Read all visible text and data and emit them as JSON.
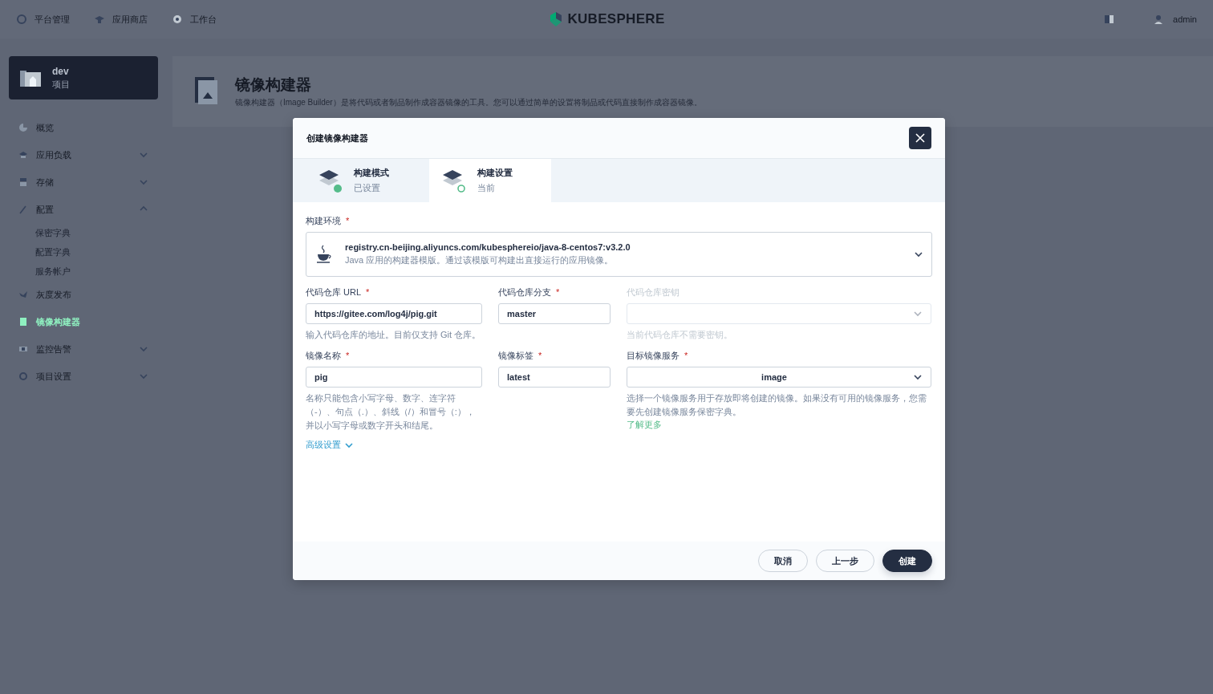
{
  "top_nav": {
    "items": [
      {
        "label": "平台管理"
      },
      {
        "label": "应用商店"
      },
      {
        "label": "工作台"
      }
    ],
    "logo": "KUBESPHERE",
    "user": "admin"
  },
  "sidebar": {
    "project": {
      "name": "dev",
      "type": "项目"
    },
    "items": [
      {
        "label": "概览",
        "kind": "link",
        "selected": false
      },
      {
        "label": "应用负载",
        "kind": "group",
        "expanded": false,
        "selected": false
      },
      {
        "label": "存储",
        "kind": "group",
        "expanded": false,
        "selected": false
      },
      {
        "label": "配置",
        "kind": "group",
        "expanded": true,
        "selected": false,
        "children": [
          {
            "label": "保密字典",
            "selected": false
          },
          {
            "label": "配置字典",
            "selected": false
          },
          {
            "label": "服务帐户",
            "selected": false
          }
        ]
      },
      {
        "label": "灰度发布",
        "kind": "link",
        "selected": false
      },
      {
        "label": "镜像构建器",
        "kind": "link",
        "selected": true
      },
      {
        "label": "监控告警",
        "kind": "group",
        "expanded": false,
        "selected": false
      },
      {
        "label": "项目设置",
        "kind": "group",
        "expanded": false,
        "selected": false
      }
    ]
  },
  "page_header": {
    "title": "镜像构建器",
    "description": "镜像构建器（Image Builder）是将代码或者制品制作成容器镜像的工具。您可以通过简单的设置将制品或代码直接制作成容器镜像。"
  },
  "modal": {
    "title": "创建镜像构建器",
    "required_mark": "*",
    "steps": [
      {
        "title": "构建模式",
        "status": "已设置",
        "done": true,
        "selected": false
      },
      {
        "title": "构建设置",
        "status": "当前",
        "done": false,
        "selected": true
      }
    ],
    "environment": {
      "label": "构建环境",
      "required": true,
      "value": "registry.cn-beijing.aliyuncs.com/kubesphereio/java-8-centos7:v3.2.0",
      "description": "Java 应用的构建器模版。通过该模版可构建出直接运行的应用镜像。"
    },
    "fields": [
      {
        "label": "代码仓库 URL",
        "required": true,
        "kind": "input",
        "value": "https://gitee.com/log4j/pig.git",
        "hint": "输入代码仓库的地址。目前仅支持 Git 仓库。"
      },
      {
        "label": "代码仓库分支",
        "required": true,
        "kind": "input",
        "value": "master"
      },
      {
        "label": "代码仓库密钥",
        "required": false,
        "kind": "select",
        "hint": "当前代码仓库不需要密钥。",
        "disabled": true
      },
      {
        "label": "镜像名称",
        "required": true,
        "kind": "input",
        "value": "pig",
        "hint": "名称只能包含小写字母、数字、连字符（-）、句点（.）、斜线（/）和冒号（:），并以小写字母或数字开头和结尾。"
      },
      {
        "label": "镜像标签",
        "required": true,
        "kind": "input",
        "value": "latest"
      },
      {
        "label": "目标镜像服务",
        "required": true,
        "kind": "select",
        "value": "image",
        "hint": "选择一个镜像服务用于存放即将创建的镜像。如果没有可用的镜像服务，您需要先创建镜像服务保密字典。",
        "link": "了解更多",
        "disabled": false
      }
    ],
    "advanced": "高级设置",
    "buttons": [
      {
        "label": "取消",
        "kind": "secondary"
      },
      {
        "label": "上一步",
        "kind": "secondary"
      },
      {
        "label": "创建",
        "kind": "primary"
      }
    ]
  }
}
